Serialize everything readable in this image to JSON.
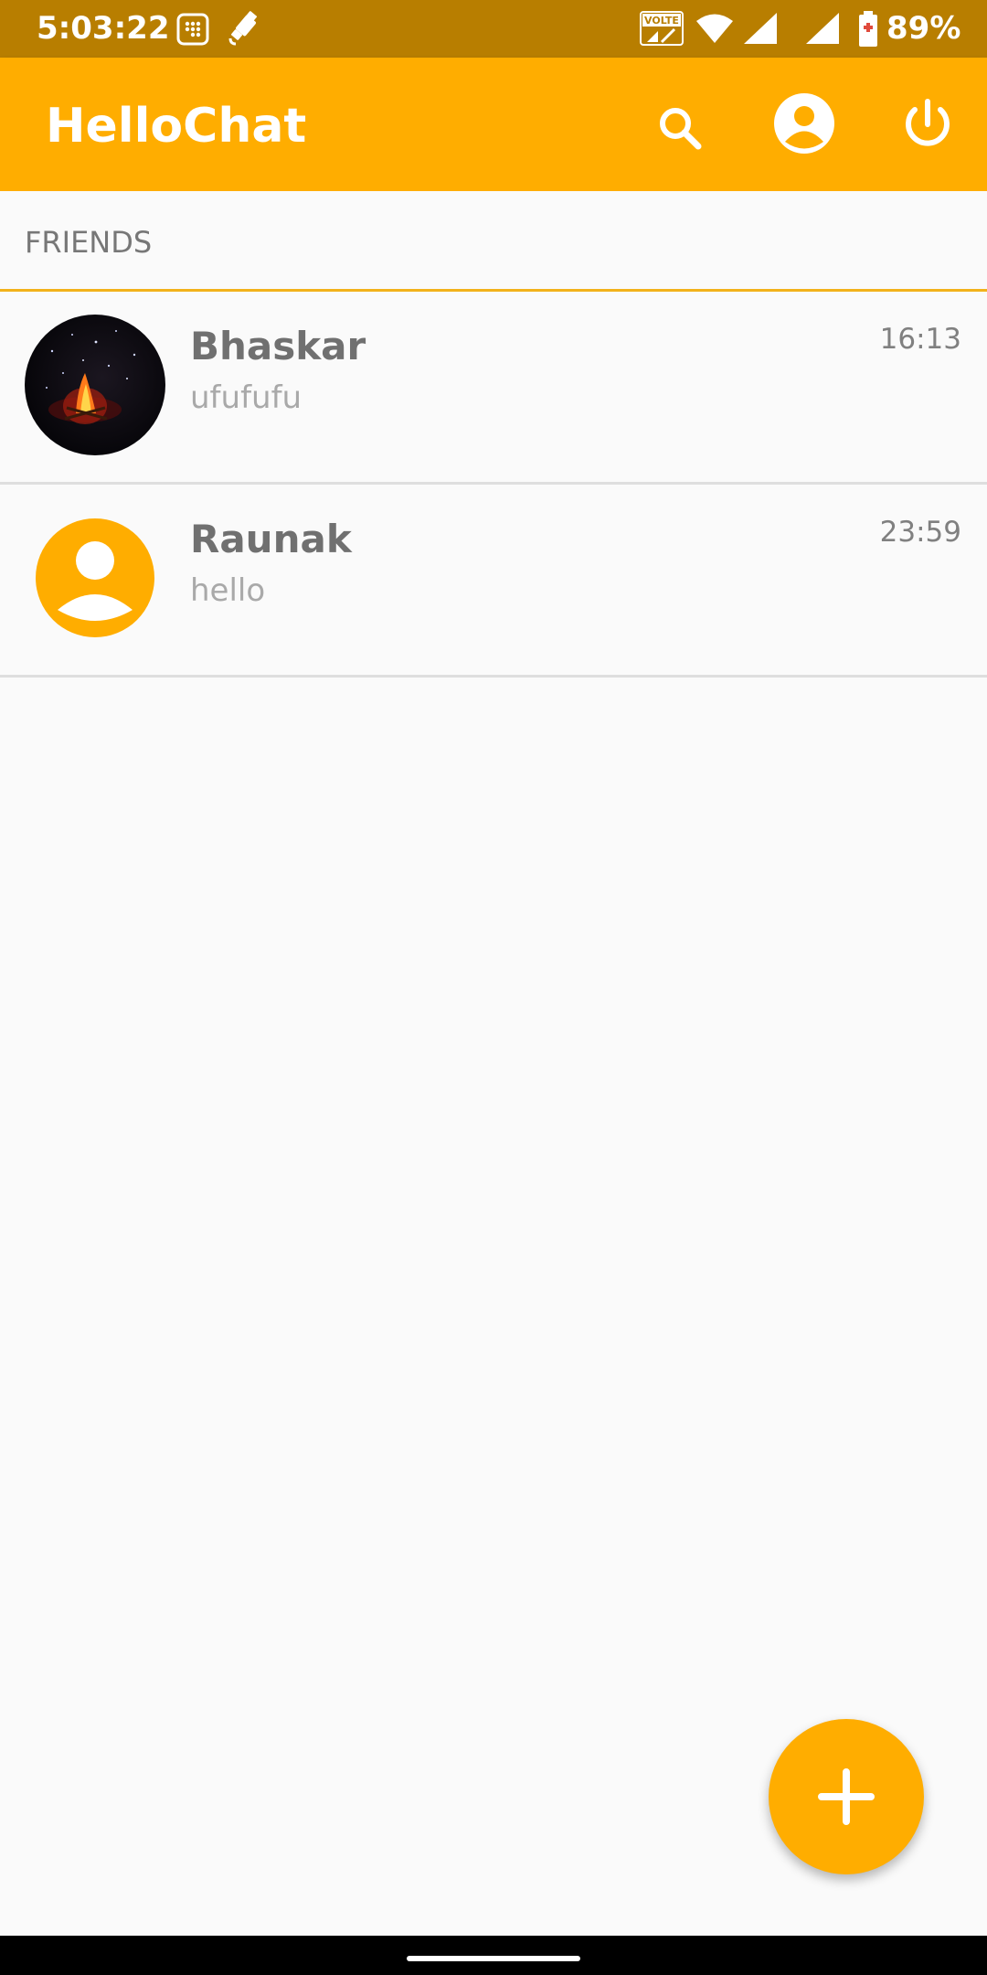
{
  "status_bar": {
    "time": "5:03:22",
    "battery_percent": "89%",
    "volte_label": "VOLTE"
  },
  "app_bar": {
    "title": "HelloChat"
  },
  "tabs": {
    "label": "FRIENDS"
  },
  "friends": [
    {
      "name": "Bhaskar",
      "last_message": "ufufufu",
      "time": "16:13"
    },
    {
      "name": "Raunak",
      "last_message": "hello",
      "time": "23:59"
    }
  ],
  "colors": {
    "primary": "#ffad00",
    "status_bar": "#b87e00",
    "divider": "#dedede",
    "accent_line": "#f2b21b"
  }
}
